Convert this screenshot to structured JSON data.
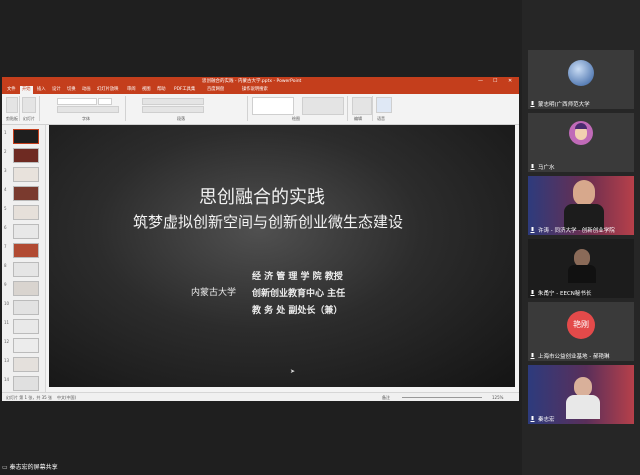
{
  "ppt": {
    "window_title": "思创融合的实践 - 内蒙古大学.pptx - PowerPoint",
    "menus": [
      "文件",
      "开始",
      "插入",
      "设计",
      "切换",
      "动画",
      "幻灯片放映",
      "审阅",
      "视图",
      "帮助",
      "PDF工具集",
      "百度网盘",
      "操作说明搜索"
    ],
    "ribbon_groups": [
      "剪贴板",
      "幻灯片",
      "字体",
      "段落",
      "绘图",
      "编辑",
      "语音"
    ],
    "slide": {
      "title": "思创融合的实践",
      "subtitle": "筑梦虚拟创新空间与创新创业微生态建设",
      "org": "内蒙古大学",
      "line1": "经 济 管 理 学 院   教授",
      "line2": "创新创业教育中心   主任",
      "line3": "教        务        处   副处长（兼）"
    },
    "status": {
      "slide_count": "幻灯片 第 1 张，共 35 张",
      "language": "中文(中国)",
      "zoom": "125%",
      "notes": "备注"
    },
    "thumb_numbers": [
      "1",
      "2",
      "3",
      "4",
      "5",
      "6",
      "7",
      "8",
      "9",
      "10",
      "11",
      "12",
      "13",
      "14"
    ]
  },
  "participants": [
    {
      "name": "蒙志明(广西师范大学",
      "avatar": "globe"
    },
    {
      "name": "马广水",
      "avatar": "cartoon"
    },
    {
      "name": "许涛 - 同济大学 · 创新创业学院",
      "avatar": "video"
    },
    {
      "name": "朱甬宁 - EECN秘书长",
      "avatar": "video"
    },
    {
      "name": "上海市公益创业基地 - 郝艳琳",
      "avatar": "text",
      "avatar_text": "艳刚"
    },
    {
      "name": "秦志宏",
      "avatar": "video"
    }
  ],
  "share_label": "秦志宏的屏幕共享",
  "colors": {
    "ppt_red": "#c43e1c",
    "avatar_red": "#e34a4a"
  }
}
